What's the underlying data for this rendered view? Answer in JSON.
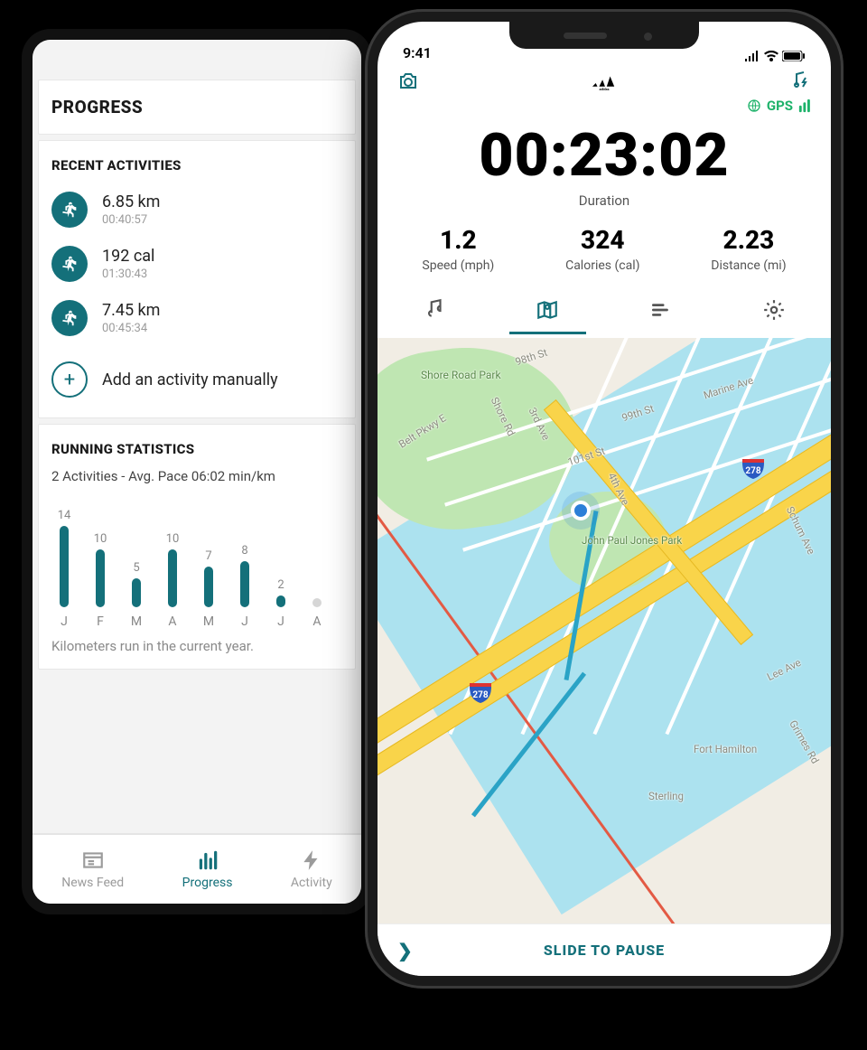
{
  "leftPhone": {
    "headerTitle": "PROGRESS",
    "recent": {
      "title": "RECENT ACTIVITIES",
      "items": [
        {
          "main": "6.85 km",
          "sub": "00:40:57"
        },
        {
          "main": "192 cal",
          "sub": "01:30:43"
        },
        {
          "main": "7.45 km",
          "sub": "00:45:34"
        }
      ],
      "addLabel": "Add an activity manually"
    },
    "stats": {
      "title": "RUNNING STATISTICS",
      "subtitle": "2 Activities - Avg. Pace 06:02 min/km",
      "caption": "Kilometers run in the current year."
    },
    "nav": {
      "newsFeed": "News Feed",
      "progress": "Progress",
      "activity": "Activity"
    }
  },
  "chart_data": {
    "type": "bar",
    "categories": [
      "J",
      "F",
      "M",
      "A",
      "M",
      "J",
      "J",
      "A"
    ],
    "values": [
      14,
      10,
      5,
      10,
      7,
      8,
      2,
      null
    ],
    "ylabel": "Kilometers",
    "title": "Kilometers run in the current year.",
    "ylim": [
      0,
      14
    ]
  },
  "rightPhone": {
    "statusTime": "9:41",
    "gpsLabel": "GPS",
    "timer": "00:23:02",
    "timerLabel": "Duration",
    "metrics": [
      {
        "value": "1.2",
        "label": "Speed (mph)"
      },
      {
        "value": "324",
        "label": "Calories (cal)"
      },
      {
        "value": "2.23",
        "label": "Distance (mi)"
      }
    ],
    "slideLabel": "SLIDE TO PAUSE",
    "map": {
      "labels": {
        "shoreRoadPark": "Shore Road Park",
        "beltPkwy": "Belt Pkwy E",
        "shoreRd": "Shore Rd",
        "thirdAve": "3rd Ave",
        "fourthAve": "4th Ave",
        "st98": "98th St",
        "st99": "99th St",
        "st101": "101st St",
        "marineAve": "Marine Ave",
        "schumAve": "Schum Ave",
        "jpJones": "John Paul Jones Park",
        "fortHamilton": "Fort Hamilton",
        "grimesRd": "Grimes Rd",
        "leeAve": "Lee Ave",
        "sterling": "Sterling"
      },
      "shield": "278"
    }
  }
}
